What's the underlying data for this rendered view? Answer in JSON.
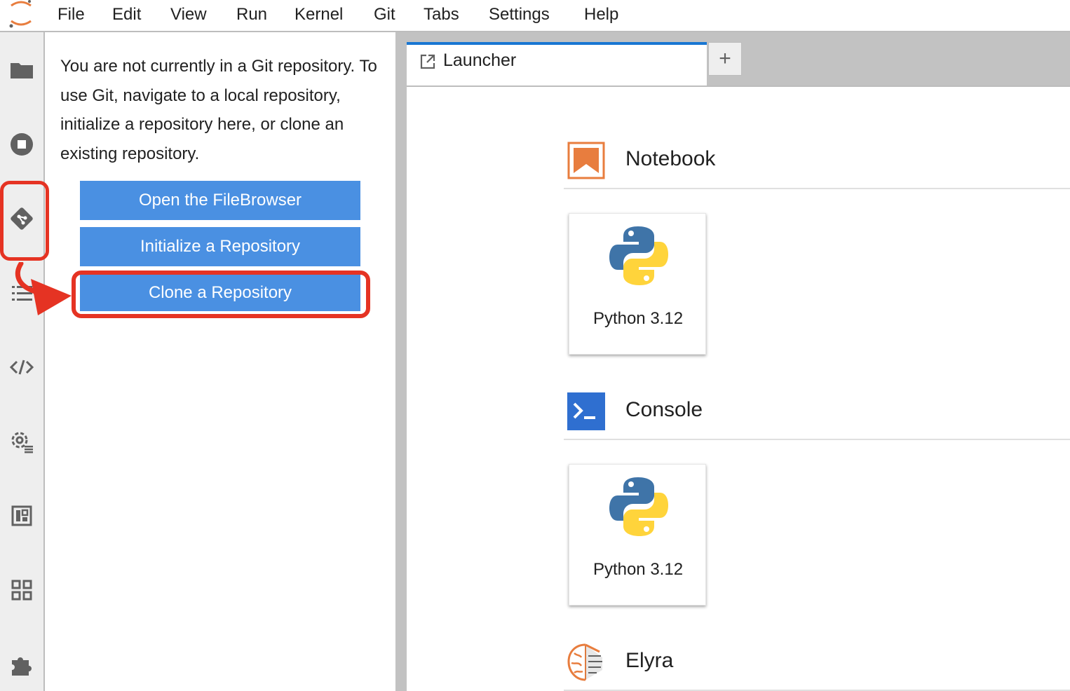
{
  "menubar": {
    "items": [
      "File",
      "Edit",
      "View",
      "Run",
      "Kernel",
      "Git",
      "Tabs",
      "Settings",
      "Help"
    ]
  },
  "activity_icons": [
    "folder-icon",
    "running-stop-icon",
    "git-icon",
    "toc-list-icon",
    "code-snippet-icon",
    "property-inspector-icon",
    "palette-icon",
    "pipeline-icon",
    "extension-puzzle-icon"
  ],
  "git_panel": {
    "message": "You are not currently in a Git repository. To use Git, navigate to a local repository, initialize a repository here, or clone an existing repository.",
    "buttons": {
      "open_filebrowser": "Open the FileBrowser",
      "init_repo": "Initialize a Repository",
      "clone_repo": "Clone a Repository"
    }
  },
  "tabs": {
    "launcher_label": "Launcher",
    "new_tab_label": "+"
  },
  "launcher": {
    "sections": {
      "notebook": {
        "title": "Notebook",
        "kernel": "Python 3.12"
      },
      "console": {
        "title": "Console",
        "kernel": "Python 3.12"
      },
      "elyra": {
        "title": "Elyra"
      }
    }
  },
  "colors": {
    "accent": "#1976d2",
    "button": "#4a90e2",
    "highlight": "#e53323",
    "notebook_orange": "#e87d3e",
    "console_blue": "#2f6fd0"
  }
}
